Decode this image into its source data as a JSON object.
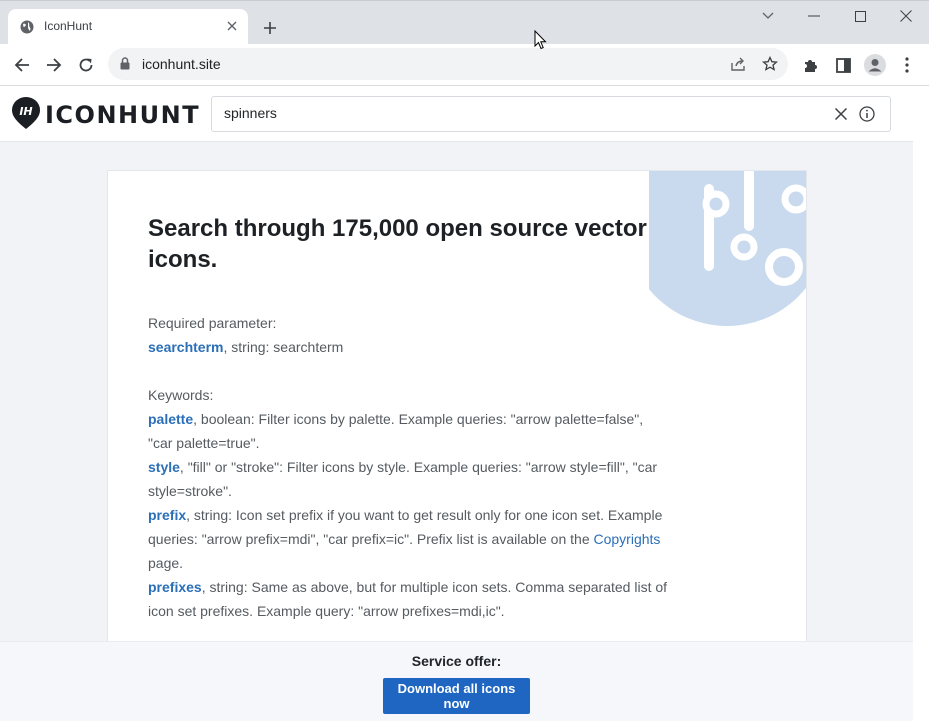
{
  "browser": {
    "tab_title": "IconHunt",
    "url": "iconhunt.site"
  },
  "site": {
    "logo_text": "ICONHUNT",
    "logo_mark": "IH",
    "search": {
      "value": "spinners"
    }
  },
  "card": {
    "title": "Search through 175,000 open source vector icons.",
    "required_label": "Required parameter:",
    "required": {
      "name": "searchterm",
      "desc": ", string: searchterm"
    },
    "keywords_label": "Keywords:",
    "keywords": [
      {
        "name": "palette",
        "desc": ", boolean: Filter icons by palette. Example queries: \"arrow palette=false\", \"car palette=true\"."
      },
      {
        "name": "style",
        "desc": ", \"fill\" or \"stroke\": Filter icons by style. Example queries: \"arrow style=fill\", \"car style=stroke\"."
      },
      {
        "name": "prefix",
        "desc": ", string: Icon set prefix if you want to get result only for one icon set. Example queries: \"arrow prefix=mdi\", \"car prefix=ic\". Prefix list is available on the ",
        "link": "Copyrights",
        "after": " page."
      },
      {
        "name": "prefixes",
        "desc": ", string: Same as above, but for multiple icon sets. Comma separated list of icon set prefixes. Example query: \"arrow prefixes=mdi,ic\"."
      }
    ]
  },
  "offer": {
    "label": "Service offer:",
    "button": "Download all icons now"
  },
  "colors": {
    "accent": "#2a6fb8",
    "button": "#1f66c2",
    "deco": "#c9daee"
  }
}
